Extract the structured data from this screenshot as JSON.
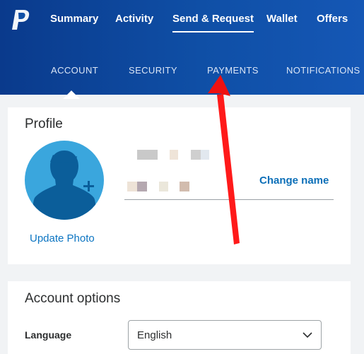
{
  "header": {
    "logo_icon": "paypal-logo",
    "main_nav": [
      "Summary",
      "Activity",
      "Send & Request",
      "Wallet",
      "Offers"
    ],
    "active_main_index": 2,
    "sub_nav": [
      "ACCOUNT",
      "SECURITY",
      "PAYMENTS",
      "NOTIFICATIONS"
    ],
    "active_sub_index": 0
  },
  "profile": {
    "title": "Profile",
    "update_photo_label": "Update Photo",
    "change_name_label": "Change name",
    "avatar_icon": "user-avatar-add-icon"
  },
  "account_options": {
    "title": "Account options",
    "language_label": "Language",
    "language_value": "English"
  },
  "colors": {
    "header": "#0f4fa6",
    "link": "#0c75c2",
    "annotation_arrow": "#ff1a1a"
  }
}
